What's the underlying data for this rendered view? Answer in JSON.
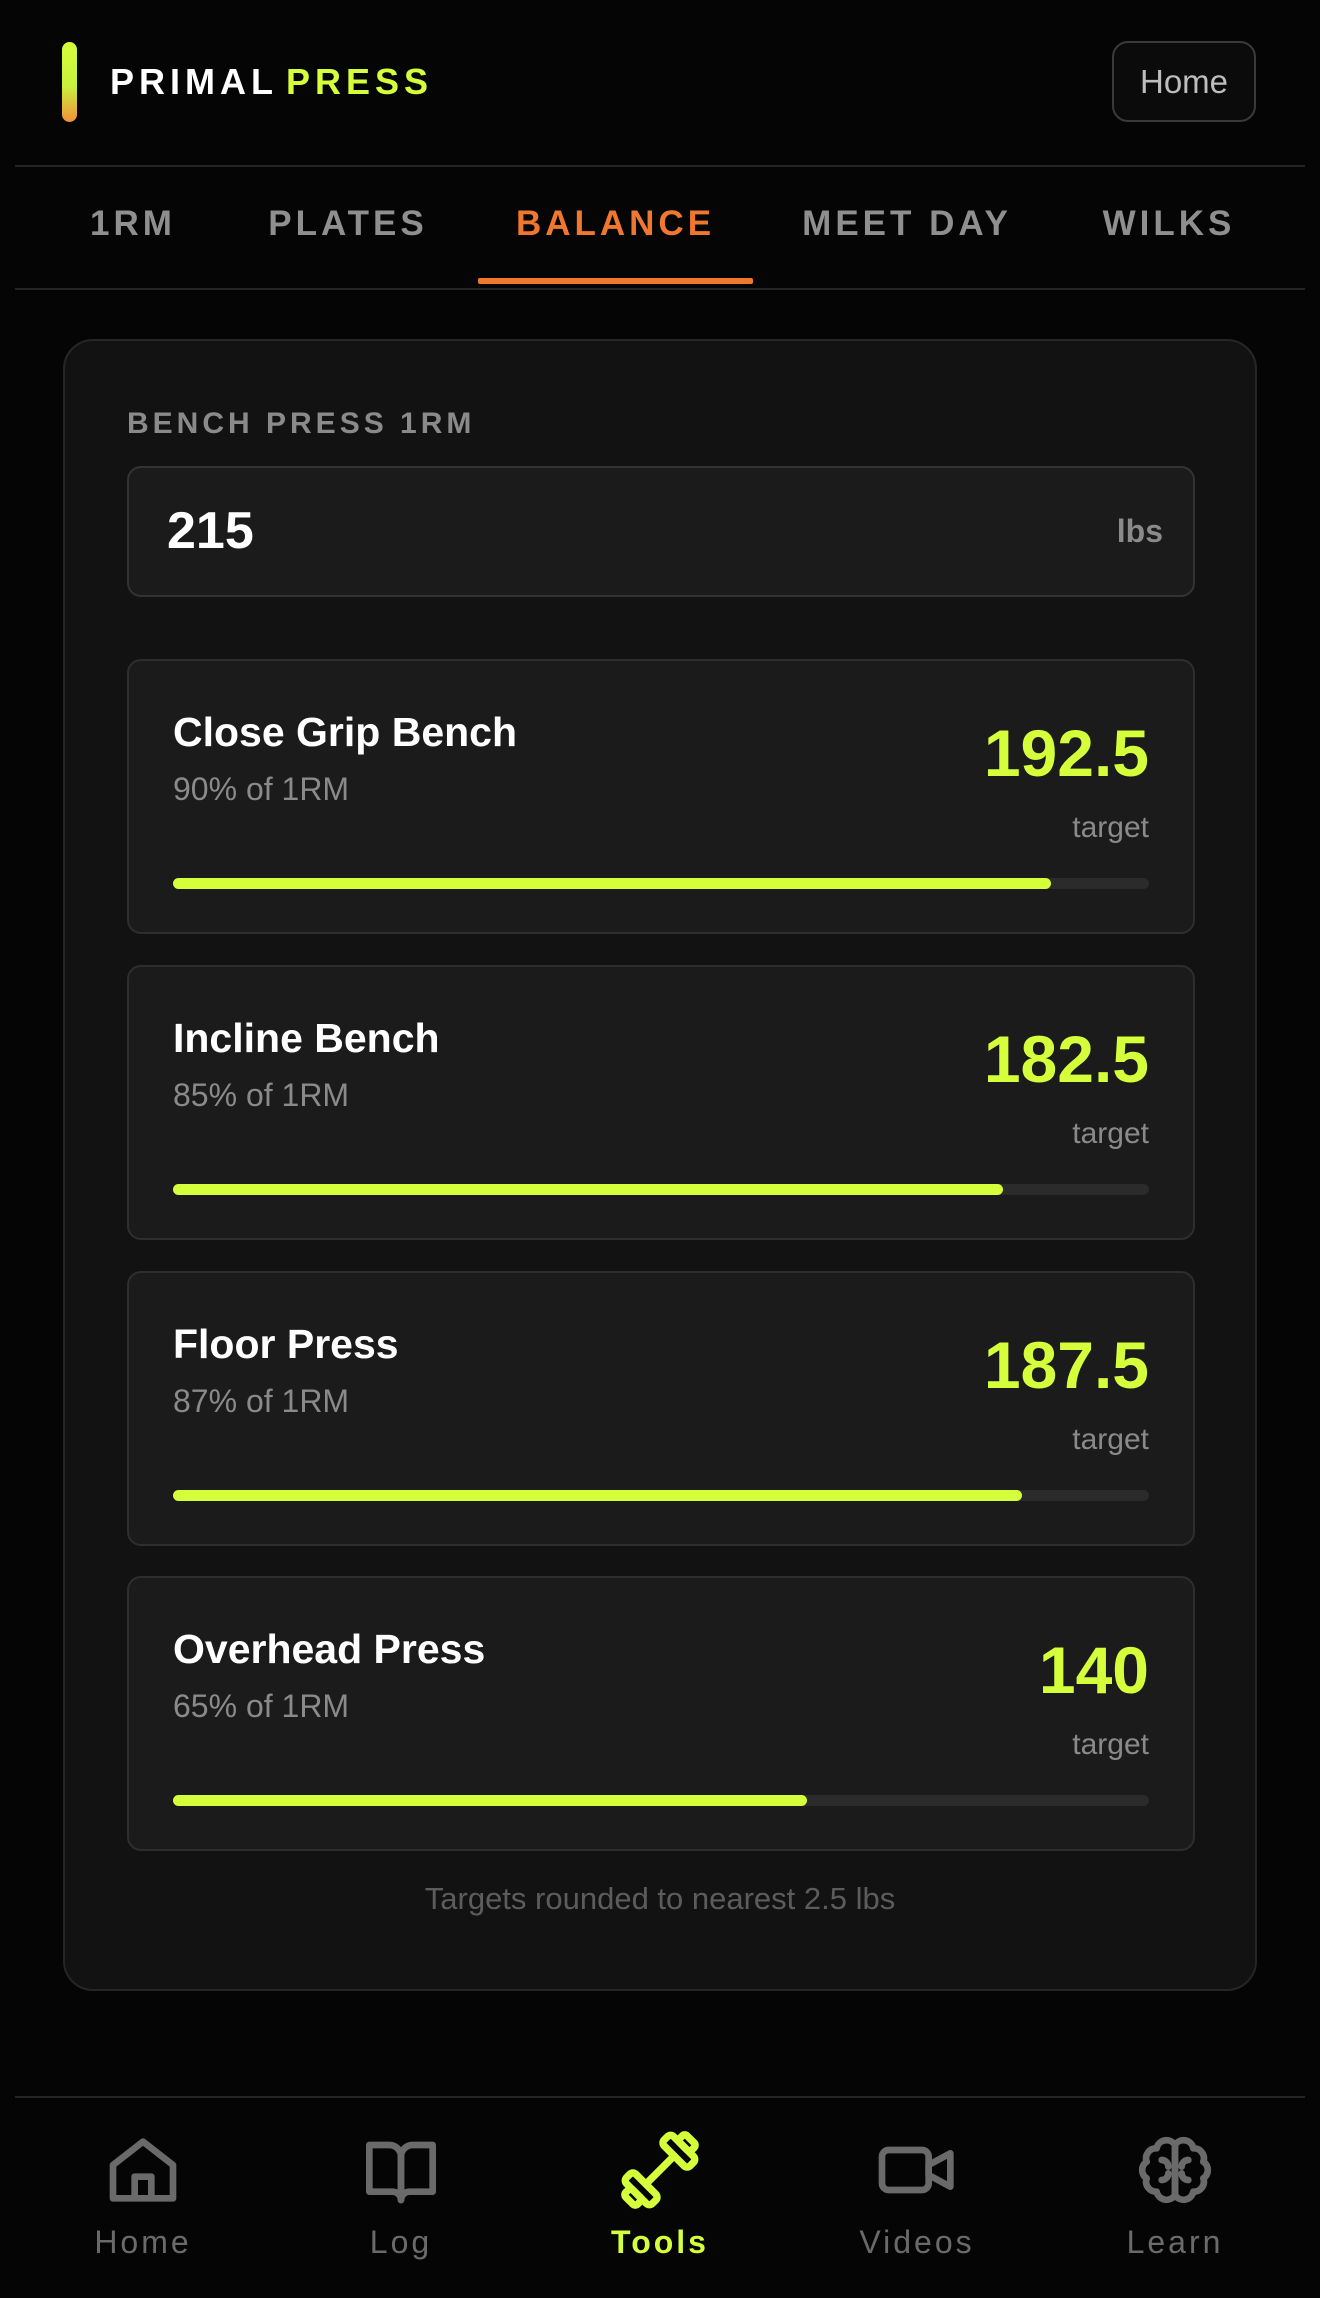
{
  "header": {
    "brand_word1": "PRIMAL",
    "brand_word2": "PRESS",
    "home_button": "Home"
  },
  "tabs": [
    {
      "label": "1RM",
      "active": false
    },
    {
      "label": "PLATES",
      "active": false
    },
    {
      "label": "BALANCE",
      "active": true
    },
    {
      "label": "MEET DAY",
      "active": false
    },
    {
      "label": "WILKS",
      "active": false
    }
  ],
  "balance": {
    "input_label": "BENCH PRESS 1RM",
    "input_value": "215",
    "input_unit": "lbs",
    "lifts": [
      {
        "name": "Close Grip Bench",
        "percent_text": "90% of 1RM",
        "value": "192.5",
        "value_caption": "target",
        "progress": 0.9
      },
      {
        "name": "Incline Bench",
        "percent_text": "85% of 1RM",
        "value": "182.5",
        "value_caption": "target",
        "progress": 0.85
      },
      {
        "name": "Floor Press",
        "percent_text": "87% of 1RM",
        "value": "187.5",
        "value_caption": "target",
        "progress": 0.87
      },
      {
        "name": "Overhead Press",
        "percent_text": "65% of 1RM",
        "value": "140",
        "value_caption": "target",
        "progress": 0.65
      }
    ],
    "footnote": "Targets rounded to nearest 2.5 lbs"
  },
  "bottom_nav": [
    {
      "label": "Home",
      "icon": "home-icon",
      "active": false
    },
    {
      "label": "Log",
      "icon": "book-icon",
      "active": false
    },
    {
      "label": "Tools",
      "icon": "dumbbell-icon",
      "active": true
    },
    {
      "label": "Videos",
      "icon": "video-camera-icon",
      "active": false
    },
    {
      "label": "Learn",
      "icon": "brain-icon",
      "active": false
    }
  ],
  "colors": {
    "accent_lime": "#d4ff3a",
    "accent_orange": "#f0772e",
    "background": "#050505",
    "card": "#121212"
  }
}
